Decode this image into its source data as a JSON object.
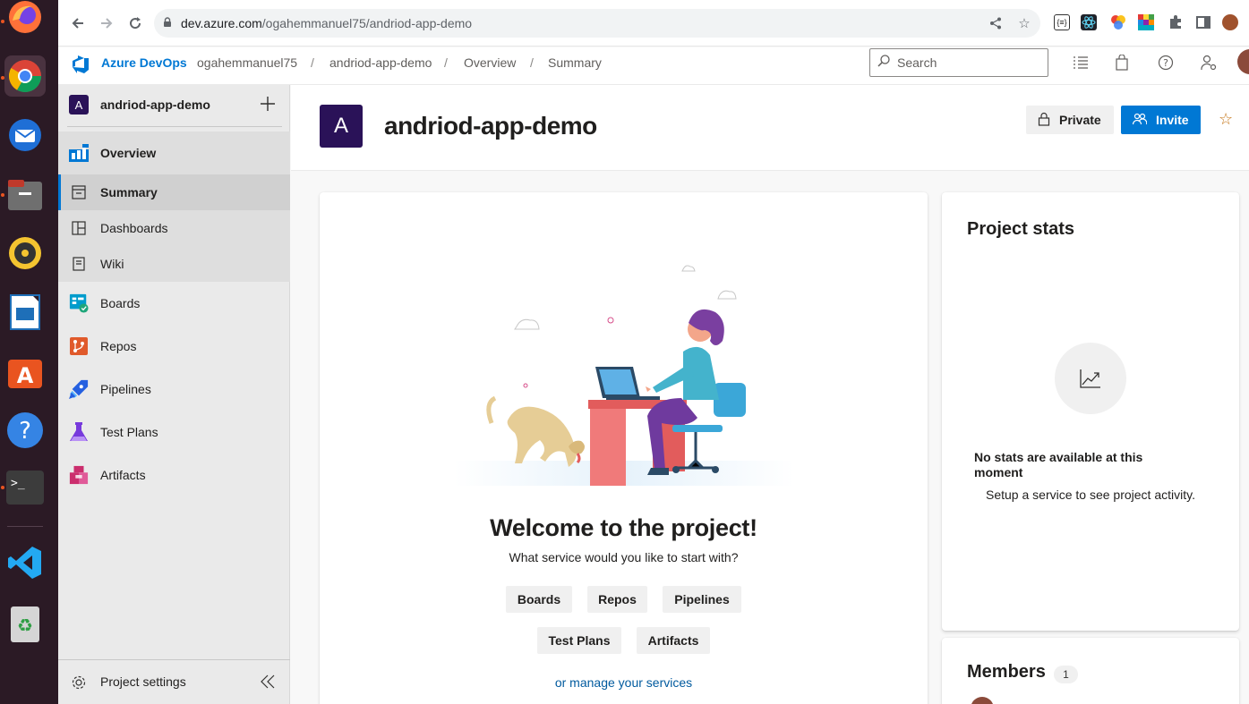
{
  "browser": {
    "url_domain": "dev.azure.com",
    "url_path": "/ogahemmanuel75/andriod-app-demo"
  },
  "header": {
    "brand": "Azure DevOps",
    "breadcrumbs": [
      "ogahemmanuel75",
      "andriod-app-demo",
      "Overview",
      "Summary"
    ],
    "separator": "/",
    "search_placeholder": "Search"
  },
  "sidebar": {
    "project_initial": "A",
    "project_name": "andriod-app-demo",
    "items": [
      {
        "label": "Overview",
        "icon": "overview-icon"
      },
      {
        "label": "Summary",
        "icon": "summary-icon"
      },
      {
        "label": "Dashboards",
        "icon": "dashboards-icon"
      },
      {
        "label": "Wiki",
        "icon": "wiki-icon"
      },
      {
        "label": "Boards",
        "icon": "boards-icon"
      },
      {
        "label": "Repos",
        "icon": "repos-icon"
      },
      {
        "label": "Pipelines",
        "icon": "pipelines-icon"
      },
      {
        "label": "Test Plans",
        "icon": "test-plans-icon"
      },
      {
        "label": "Artifacts",
        "icon": "artifacts-icon"
      }
    ],
    "settings_label": "Project settings"
  },
  "main": {
    "project_initial": "A",
    "project_title": "andriod-app-demo",
    "private_label": "Private",
    "invite_label": "Invite",
    "welcome": {
      "title": "Welcome to the project!",
      "subtitle": "What service would you like to start with?",
      "services": [
        "Boards",
        "Repos",
        "Pipelines",
        "Test Plans",
        "Artifacts"
      ],
      "manage_link": "or manage your services"
    },
    "stats": {
      "title": "Project stats",
      "empty_title": "No stats are available at this moment",
      "empty_subtitle": "Setup a service to see project activity."
    },
    "members": {
      "title": "Members",
      "count": "1"
    }
  },
  "colors": {
    "accent": "#0078d4",
    "project_avatar": "#2a1258",
    "favorite_star": "#c57619"
  }
}
